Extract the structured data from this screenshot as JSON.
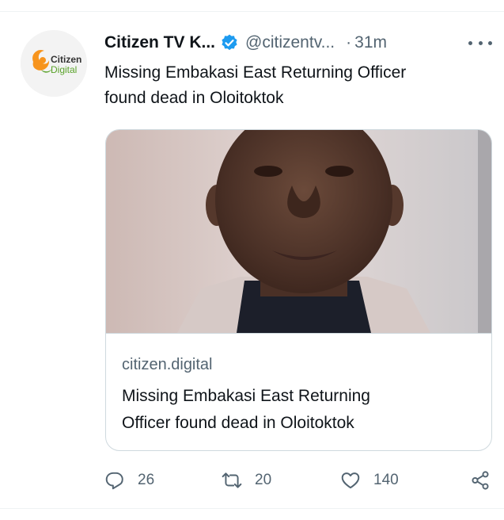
{
  "tweet": {
    "author": {
      "display_name": "Citizen TV K...",
      "handle": "@citizentv...",
      "avatar": {
        "brand_line1": "Citizen",
        "brand_line2": "Digital",
        "colors": {
          "primary": "#f7941d",
          "secondary": "#5ba32b"
        }
      },
      "verified": true
    },
    "separator": "·",
    "time": "31m",
    "more_icon": "more-horizontal-icon",
    "text_line1": "Missing Embakasi East Returning Officer",
    "text_line2": "found dead in Oloitoktok",
    "card": {
      "domain": "citizen.digital",
      "title_line1": "Missing Embakasi East Returning",
      "title_line2": "Officer found dead in Oloitoktok"
    },
    "actions": {
      "reply": {
        "icon": "reply-icon",
        "count": "26"
      },
      "retweet": {
        "icon": "retweet-icon",
        "count": "20"
      },
      "like": {
        "icon": "heart-icon",
        "count": "140"
      },
      "share": {
        "icon": "share-icon"
      }
    }
  },
  "colors": {
    "verified": "#1d9bf0",
    "text_primary": "#0f1419",
    "text_secondary": "#536471",
    "border": "#cfd9de"
  }
}
